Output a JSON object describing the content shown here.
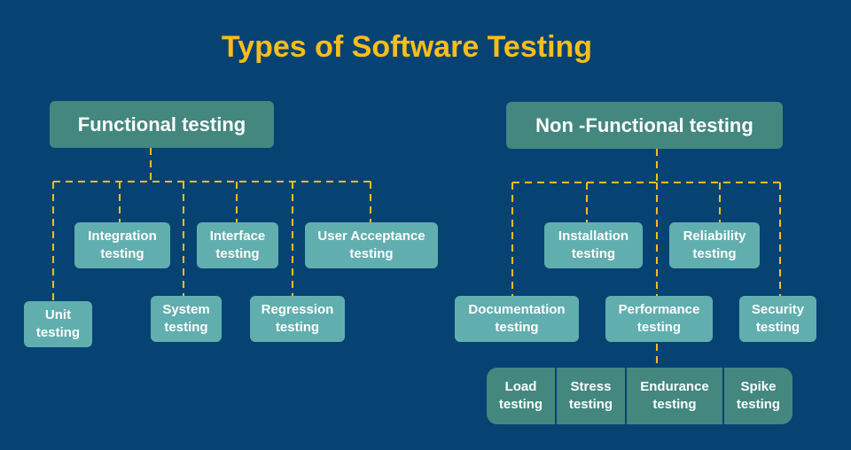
{
  "title": "Types of Software Testing",
  "colors": {
    "background": "#064373",
    "title": "#fbbd1c",
    "root": "#43877f",
    "leaf": "#61aeaf",
    "connector": "#fbbd1c"
  },
  "functional": {
    "label": "Functional testing",
    "children": [
      "Unit\ntesting",
      "Integration\ntesting",
      "System\ntesting",
      "Interface\ntesting",
      "Regression\ntesting",
      "User Acceptance\ntesting"
    ]
  },
  "non_functional": {
    "label": "Non -Functional testing",
    "children": [
      "Documentation\ntesting",
      "Installation\ntesting",
      "Performance\ntesting",
      "Reliability\ntesting",
      "Security\ntesting"
    ],
    "performance_children": [
      "Load\ntesting",
      "Stress\ntesting",
      "Endurance\ntesting",
      "Spike\ntesting"
    ]
  }
}
